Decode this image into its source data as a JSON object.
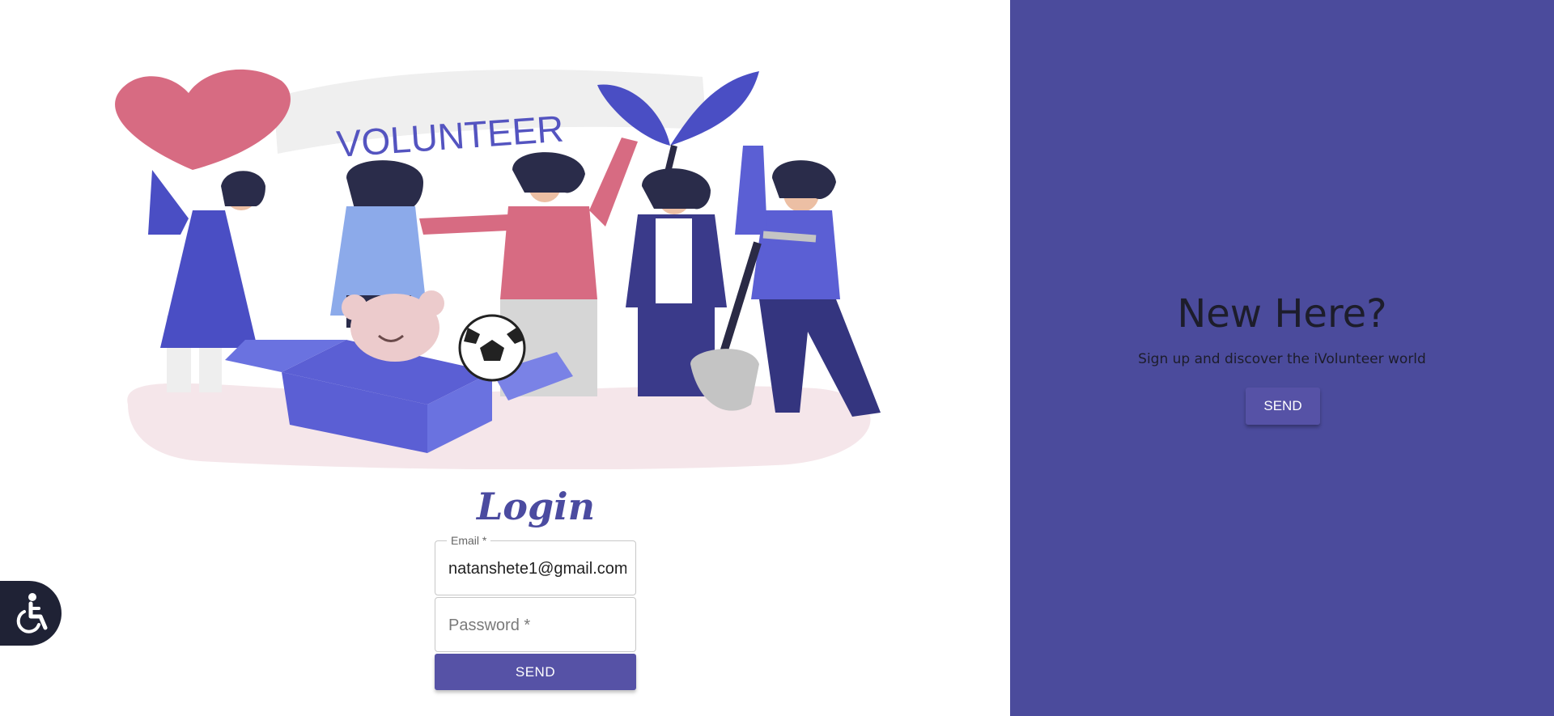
{
  "illustration": {
    "banner_text": "VOLUNTEER"
  },
  "login": {
    "title": "Login",
    "email_label": "Email *",
    "email_value": "natanshete1@gmail.com",
    "password_placeholder": "Password *",
    "send_label": "SEND"
  },
  "signup": {
    "heading": "New Here?",
    "text": "Sign up and discover the iVolunteer world",
    "send_label": "SEND"
  },
  "colors": {
    "brand_purple": "#4b4b9c",
    "button_purple": "#5652a6",
    "heart_pink": "#d76b82",
    "accessibility_dark": "#1f2235"
  },
  "icons": {
    "accessibility": "wheelchair-icon"
  }
}
